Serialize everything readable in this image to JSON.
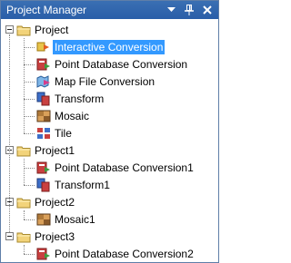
{
  "panel": {
    "title": "Project Manager",
    "pin_glyph": "❘",
    "close_glyph": "✕",
    "dropdown_icon": "chevron-down-icon",
    "accent": "#2a5ea8",
    "selection": "#3399ff"
  },
  "tree": {
    "projects": [
      {
        "label": "Project",
        "expanded": true,
        "children": [
          {
            "label": "Interactive Conversion",
            "icon": "interactive-conversion-icon",
            "selected": true
          },
          {
            "label": "Point Database Conversion",
            "icon": "point-database-icon"
          },
          {
            "label": "Map File Conversion",
            "icon": "map-file-icon"
          },
          {
            "label": "Transform",
            "icon": "transform-icon"
          },
          {
            "label": "Mosaic",
            "icon": "mosaic-icon"
          },
          {
            "label": "Tile",
            "icon": "tile-icon"
          }
        ]
      },
      {
        "label": "Project1",
        "expanded": true,
        "children": [
          {
            "label": "Point Database Conversion1",
            "icon": "point-database-icon"
          },
          {
            "label": "Transform1",
            "icon": "transform-icon"
          }
        ]
      },
      {
        "label": "Project2",
        "expanded": true,
        "children": [
          {
            "label": "Mosaic1",
            "icon": "mosaic-icon"
          }
        ]
      },
      {
        "label": "Project3",
        "expanded": true,
        "children": [
          {
            "label": "Point Database Conversion2",
            "icon": "point-database-icon"
          }
        ]
      }
    ]
  }
}
